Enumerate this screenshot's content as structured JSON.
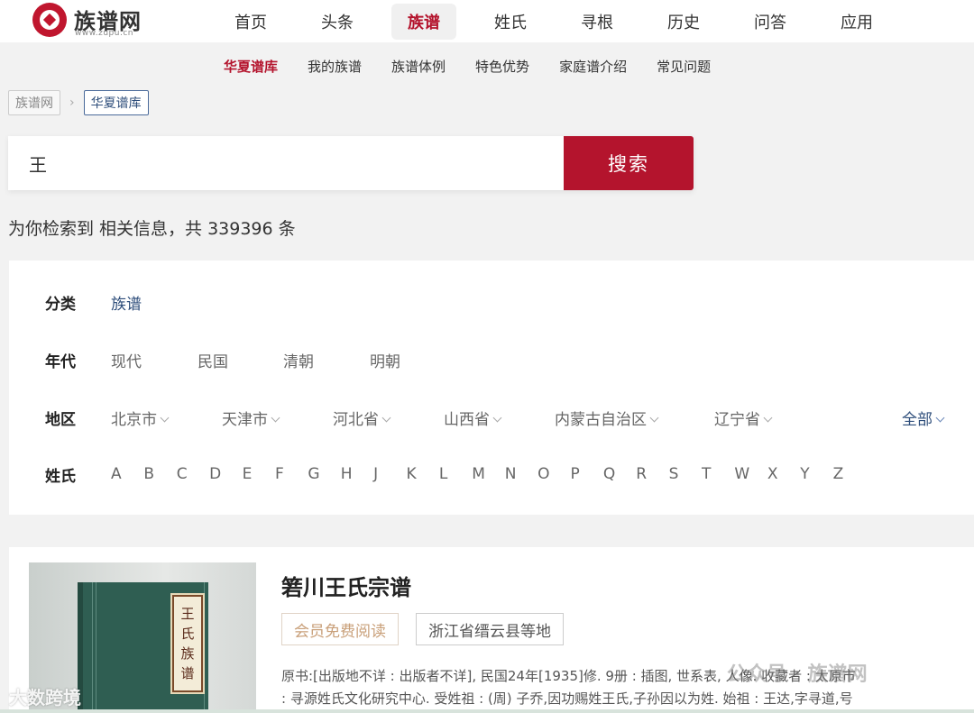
{
  "header": {
    "logo_title": "族谱网",
    "logo_url": "www.zupu.cn",
    "nav": [
      "首页",
      "头条",
      "族谱",
      "姓氏",
      "寻根",
      "历史",
      "问答",
      "应用"
    ],
    "active_nav": "族谱"
  },
  "subnav": [
    "华夏谱库",
    "我的族谱",
    "族谱体例",
    "特色优势",
    "家庭谱介绍",
    "常见问题"
  ],
  "breadcrumb": {
    "root": "族谱网",
    "separator": "›",
    "current": "华夏谱库"
  },
  "search": {
    "value": "王",
    "button": "搜索"
  },
  "result_count": "为你检索到 相关信息，共 339396 条",
  "filters": {
    "category": {
      "label": "分类",
      "options": [
        "族谱"
      ]
    },
    "era": {
      "label": "年代",
      "options": [
        "现代",
        "民国",
        "清朝",
        "明朝"
      ]
    },
    "region": {
      "label": "地区",
      "options": [
        "北京市",
        "天津市",
        "河北省",
        "山西省",
        "内蒙古自治区",
        "辽宁省"
      ],
      "all": "全部"
    },
    "surname": {
      "label": "姓氏",
      "letters": [
        "A",
        "B",
        "C",
        "D",
        "E",
        "F",
        "G",
        "H",
        "J",
        "K",
        "L",
        "M",
        "N",
        "O",
        "P",
        "Q",
        "R",
        "S",
        "T",
        "W",
        "X",
        "Y",
        "Z"
      ]
    }
  },
  "result": {
    "cover_text": [
      "王",
      "氏",
      "族",
      "谱"
    ],
    "title": "箬川王氏宗谱",
    "free_tag": "会员免费阅读",
    "region_tag": "浙江省缙云县等地",
    "desc_line1": "原书:[出版地不详 : 出版者不详], 民国24年[1935]修. 9册 : 插图, 世系表, 人像. 收藏者 : 太原市",
    "desc_line2": ": 寻源姓氏文化研究中心. 受姓祖 : (周) 子乔,因功赐姓王氏,子孙因以为姓. 始祖 : 王达,字寻道,号"
  },
  "watermarks": {
    "left": "大数跨境",
    "right": "公众号 · 族谱网"
  },
  "colors": {
    "brand": "#b4142d",
    "link": "#2d4d7a"
  }
}
